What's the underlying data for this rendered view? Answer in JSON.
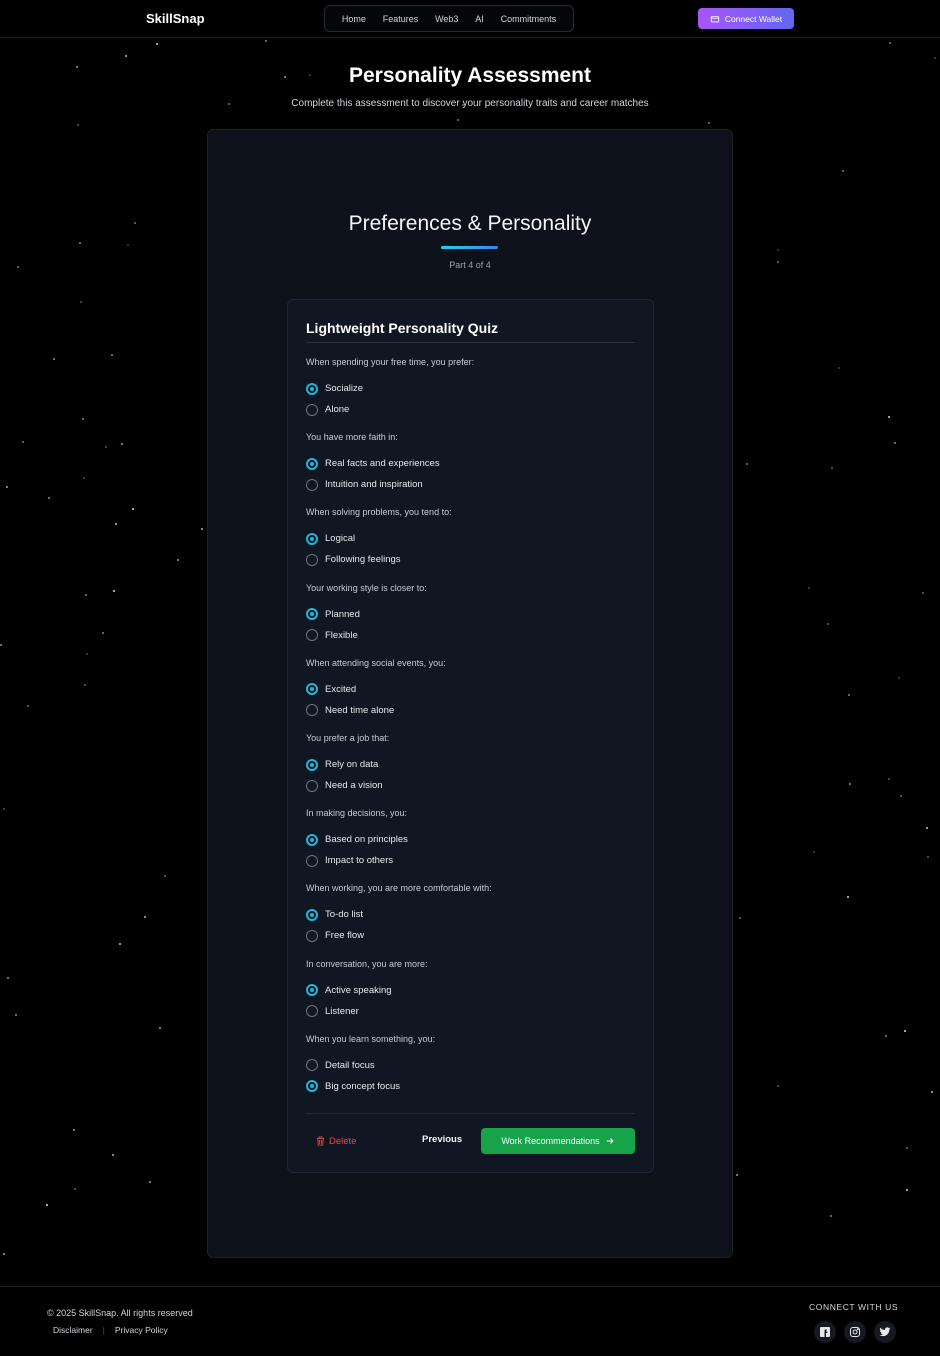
{
  "nav": {
    "logo": "SkillSnap",
    "links": [
      "Home",
      "Features",
      "Web3",
      "AI",
      "Commitments"
    ],
    "wallet_label": "Connect Wallet"
  },
  "header": {
    "title": "Personality Assessment",
    "subtitle": "Complete this assessment to discover your personality traits and career matches"
  },
  "section": {
    "title": "Preferences & Personality",
    "part": "Part 4 of 4"
  },
  "quiz": {
    "title": "Lightweight Personality Quiz",
    "questions": [
      {
        "text": "When spending your free time, you prefer:",
        "options": [
          "Socialize",
          "Alone"
        ],
        "selected": 0
      },
      {
        "text": "You have more faith in:",
        "options": [
          "Real facts and experiences",
          "Intuition and inspiration"
        ],
        "selected": 0
      },
      {
        "text": "When solving problems, you tend to:",
        "options": [
          "Logical",
          "Following feelings"
        ],
        "selected": 0
      },
      {
        "text": "Your working style is closer to:",
        "options": [
          "Planned",
          "Flexible"
        ],
        "selected": 0
      },
      {
        "text": "When attending social events, you:",
        "options": [
          "Excited",
          "Need time alone"
        ],
        "selected": 0
      },
      {
        "text": "You prefer a job that:",
        "options": [
          "Rely on data",
          "Need a vision"
        ],
        "selected": 0
      },
      {
        "text": "In making decisions, you:",
        "options": [
          "Based on principles",
          "Impact to others"
        ],
        "selected": 0
      },
      {
        "text": "When working, you are more comfortable with:",
        "options": [
          "To-do list",
          "Free flow"
        ],
        "selected": 0
      },
      {
        "text": "In conversation, you are more:",
        "options": [
          "Active speaking",
          "Listener"
        ],
        "selected": 0
      },
      {
        "text": "When you learn something, you:",
        "options": [
          "Detail focus",
          "Big concept focus"
        ],
        "selected": 1
      }
    ],
    "delete_label": "Delete",
    "previous_label": "Previous",
    "next_label": "Work Recommendations"
  },
  "footer": {
    "copyright": "© 2025 SkillSnap. All rights reserved",
    "links": [
      "Disclaimer",
      "Privacy Policy"
    ],
    "connect_label": "CONNECT WITH US",
    "socials": [
      "facebook-icon",
      "instagram-icon",
      "twitter-icon"
    ]
  },
  "colors": {
    "accent": "#22b5d9",
    "wallet_gradient": [
      "#a855f7",
      "#6366f1"
    ],
    "primary_button": "#16a34a",
    "danger": "#ef4444"
  }
}
